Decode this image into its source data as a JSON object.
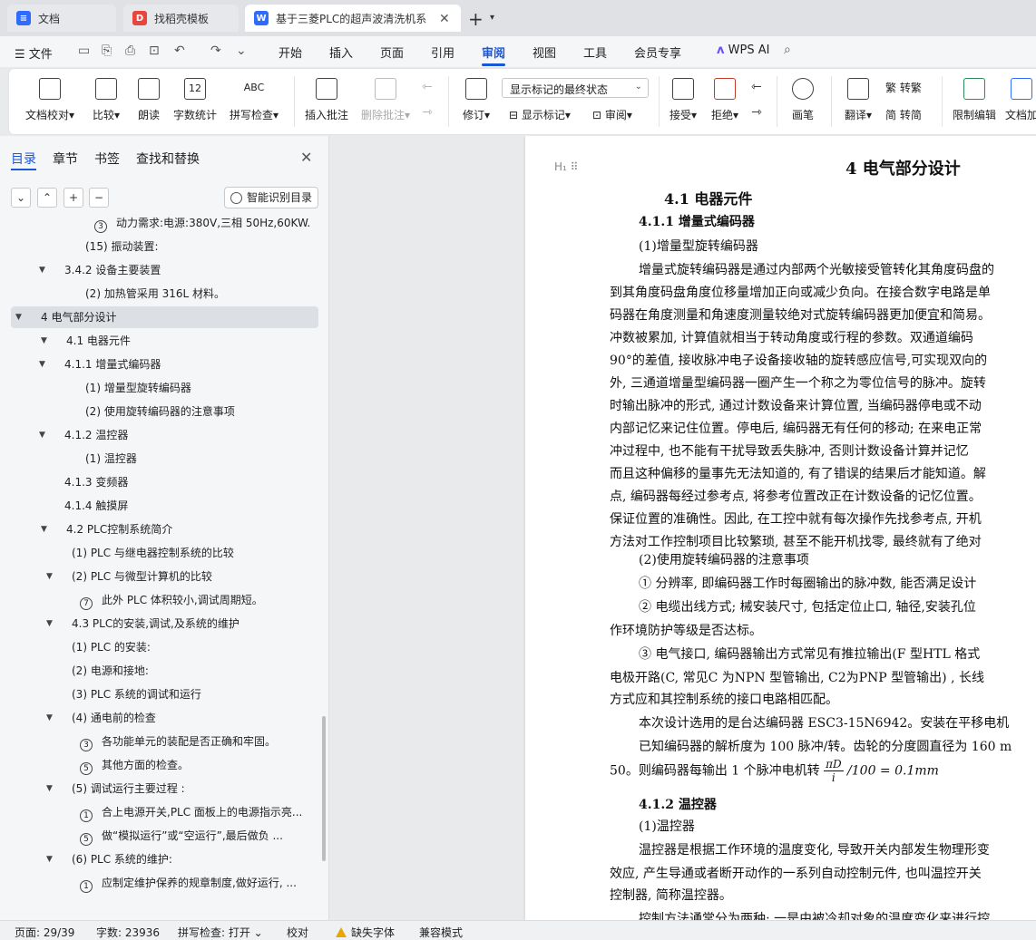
{
  "tabs": [
    {
      "label": "文档",
      "icon": "wps-docs-icon",
      "color": "#2f6bff",
      "left": 0
    },
    {
      "label": "找稻壳模板",
      "icon": "docer-icon",
      "color": "#e8453c",
      "left": 0
    },
    {
      "label": "基于三菱PLC的超声波清洗机系",
      "icon": "word-doc-icon",
      "color": "#2f6bff",
      "left": 0
    }
  ],
  "menubar": {
    "file": "文件",
    "tabs": [
      "开始",
      "插入",
      "页面",
      "引用",
      "审阅",
      "视图",
      "工具",
      "会员专享"
    ],
    "active_tab": "审阅",
    "wps_ai": "WPS AI"
  },
  "ribbon": {
    "doc_check": "文档校对",
    "compare": "比较",
    "read_aloud": "朗读",
    "word_count": "字数统计",
    "spell_check": "拼写检查",
    "word_count_icon": "12",
    "spell_icon": "ABC",
    "insert_comment": "插入批注",
    "delete_comment": "删除批注",
    "revision": "修订",
    "markup_select": "显示标记的最终状态",
    "show_markup": "显示标记",
    "review": "审阅",
    "accept": "接受",
    "reject": "拒绝",
    "pen": "画笔",
    "translate": "翻译",
    "to_traditional": "转繁",
    "to_simplified": "转简",
    "restrict_edit": "限制编辑",
    "doc_encrypt": "文档加"
  },
  "nav": {
    "tabs": [
      "目录",
      "章节",
      "书签",
      "查找和替换"
    ],
    "smart_button": "智能识别目录",
    "toc": [
      {
        "text": "动力需求:电源:380V,三相 50Hz,60KW.",
        "circle": "3",
        "indent": 104,
        "arrow": false
      },
      {
        "text": "(15) 振动装置:",
        "indent": 94,
        "arrow": false
      },
      {
        "text": "3.4.2 设备主要装置",
        "indent": 71,
        "arrow": true
      },
      {
        "text": "(2) 加热管采用 316L 材料。",
        "indent": 94,
        "arrow": false
      },
      {
        "text": "4   电气部分设计",
        "indent": 45,
        "arrow": true,
        "selected": true
      },
      {
        "text": "4.1 电器元件",
        "indent": 73,
        "arrow": true
      },
      {
        "text": "4.1.1 增量式编码器",
        "indent": 71,
        "arrow": true
      },
      {
        "text": "(1) 增量型旋转编码器",
        "indent": 94,
        "arrow": false
      },
      {
        "text": "(2) 使用旋转编码器的注意事项",
        "indent": 94,
        "arrow": false
      },
      {
        "text": "4.1.2 温控器",
        "indent": 71,
        "arrow": true
      },
      {
        "text": "(1) 温控器",
        "indent": 94,
        "arrow": false
      },
      {
        "text": "4.1.3 变频器",
        "indent": 71,
        "arrow": false
      },
      {
        "text": "4.1.4 触摸屏",
        "indent": 71,
        "arrow": false
      },
      {
        "text": "4.2   PLC控制系统简介",
        "indent": 73,
        "arrow": true
      },
      {
        "text": "(1) PLC 与继电器控制系统的比较",
        "indent": 79,
        "arrow": false
      },
      {
        "text": "(2)   PLC 与微型计算机的比较",
        "indent": 79,
        "arrow": true
      },
      {
        "text": "此外 PLC 体积较小,调试周期短。",
        "circle": "7",
        "indent": 88,
        "arrow": false
      },
      {
        "text": "4.3   PLC的安装,调试,及系统的维护",
        "indent": 79,
        "arrow": true
      },
      {
        "text": "(1) PLC 的安装:",
        "indent": 79,
        "arrow": false
      },
      {
        "text": "(2) 电源和接地:",
        "indent": 79,
        "arrow": false
      },
      {
        "text": "(3) PLC 系统的调试和运行",
        "indent": 79,
        "arrow": false
      },
      {
        "text": "(4) 通电前的检查",
        "indent": 79,
        "arrow": true
      },
      {
        "text": "各功能单元的装配是否正确和牢固。",
        "circle": "3",
        "indent": 88,
        "arrow": false
      },
      {
        "text": "其他方面的检查。",
        "circle": "5",
        "indent": 88,
        "arrow": false
      },
      {
        "text": "(5) 调试运行主要过程 :",
        "indent": 79,
        "arrow": true
      },
      {
        "text": "合上电源开关,PLC 面板上的电源指示亮...",
        "circle": "1",
        "indent": 88,
        "arrow": false
      },
      {
        "text": "做“模拟运行”或“空运行”,最后做负 ...",
        "circle": "5",
        "indent": 88,
        "arrow": false
      },
      {
        "text": "(6) PLC 系统的维护:",
        "indent": 79,
        "arrow": true
      },
      {
        "text": "应制定维护保养的规章制度,做好运行, ...",
        "circle": "1",
        "indent": 88,
        "arrow": false
      }
    ]
  },
  "doc": {
    "heading_marker": "H₁",
    "chapter_title": "4   电气部分设计",
    "section_title": "4.1 电器元件",
    "sub_4_1_1": "4.1.1  增量式编码器",
    "item_1": "(1)增量型旋转编码器",
    "p1": [
      "增量式旋转编码器是通过内部两个光敏接受管转化其角度码盘的",
      "到其角度码盘角度位移量增加正向或减少负向。在接合数字电路是单",
      "码器在角度测量和角速度测量较绝对式旋转编码器更加便宜和简易。",
      "冲数被累加, 计算值就相当于转动角度或行程的参数。双通道编码",
      "90°的差值, 接收脉冲电子设备接收轴的旋转感应信号,可实现双向的",
      "外, 三通道增量型编码器一圈产生一个称之为零位信号的脉冲。旋转",
      "时输出脉冲的形式, 通过计数设备来计算位置, 当编码器停电或不动",
      "内部记忆来记住位置。停电后, 编码器无有任何的移动; 在来电正常",
      "冲过程中, 也不能有干扰导致丢失脉冲, 否则计数设备计算并记忆",
      "而且这种偏移的量事先无法知道的, 有了错误的结果后才能知道。解",
      "点, 编码器每经过参考点, 将参考位置改正在计数设备的记忆位置。",
      "保证位置的准确性。因此, 在工控中就有每次操作先找参考点, 开机",
      "方法对工作控制项目比较繁琐, 甚至不能开机找零, 最终就有了绝对"
    ],
    "item_2": "(2)使用旋转编码器的注意事项",
    "note_1": "①  分辨率, 即编码器工作时每圈输出的脉冲数, 能否满足设计",
    "note_2": "②  电缆出线方式; 械安装尺寸, 包括定位止口, 轴径,安装孔位",
    "note_2b": "作环境防护等级是否达标。",
    "note_3": "③  电气接口, 编码器输出方式常见有推拉输出(F 型HTL 格式",
    "note_3b": "电极开路(C, 常见C 为NPN 型管输出, C2为PNP 型管输出) ,    长线",
    "note_3c": "方式应和其控制系统的接口电路相匹配。",
    "design_line": "本次设计选用的是台达编码器 ESC3-15N6942。安装在平移电机",
    "resolution_line": "已知编码器的解析度为 100 脉冲/转。齿轮的分度圆直径为 160 m",
    "formula_prefix": "50。则编码器每输出 1 个脉冲电机转",
    "formula_num": "πD",
    "formula_den": "i",
    "formula_suffix": "/100 = 0.1mm",
    "sub_4_1_2": "4.1.2 温控器",
    "item_tc": "(1)温控器",
    "tc_p1": "温控器是根据工作环境的温度变化, 导致开关内部发生物理形变",
    "tc_p2": "效应, 产生导通或者断开动作的一系列自动控制元件, 也叫温控开关",
    "tc_p3": "控制器, 简称温控器。",
    "tc_p4": "控制方法通常分为两种: 一是由被冷却对象的温度变化来进行控"
  },
  "status": {
    "page": "页面: 29/39",
    "words": "字数: 23936",
    "spell": "拼写检查: 打开",
    "proof": "校对",
    "missing_font": "缺失字体",
    "compat": "兼容模式"
  }
}
